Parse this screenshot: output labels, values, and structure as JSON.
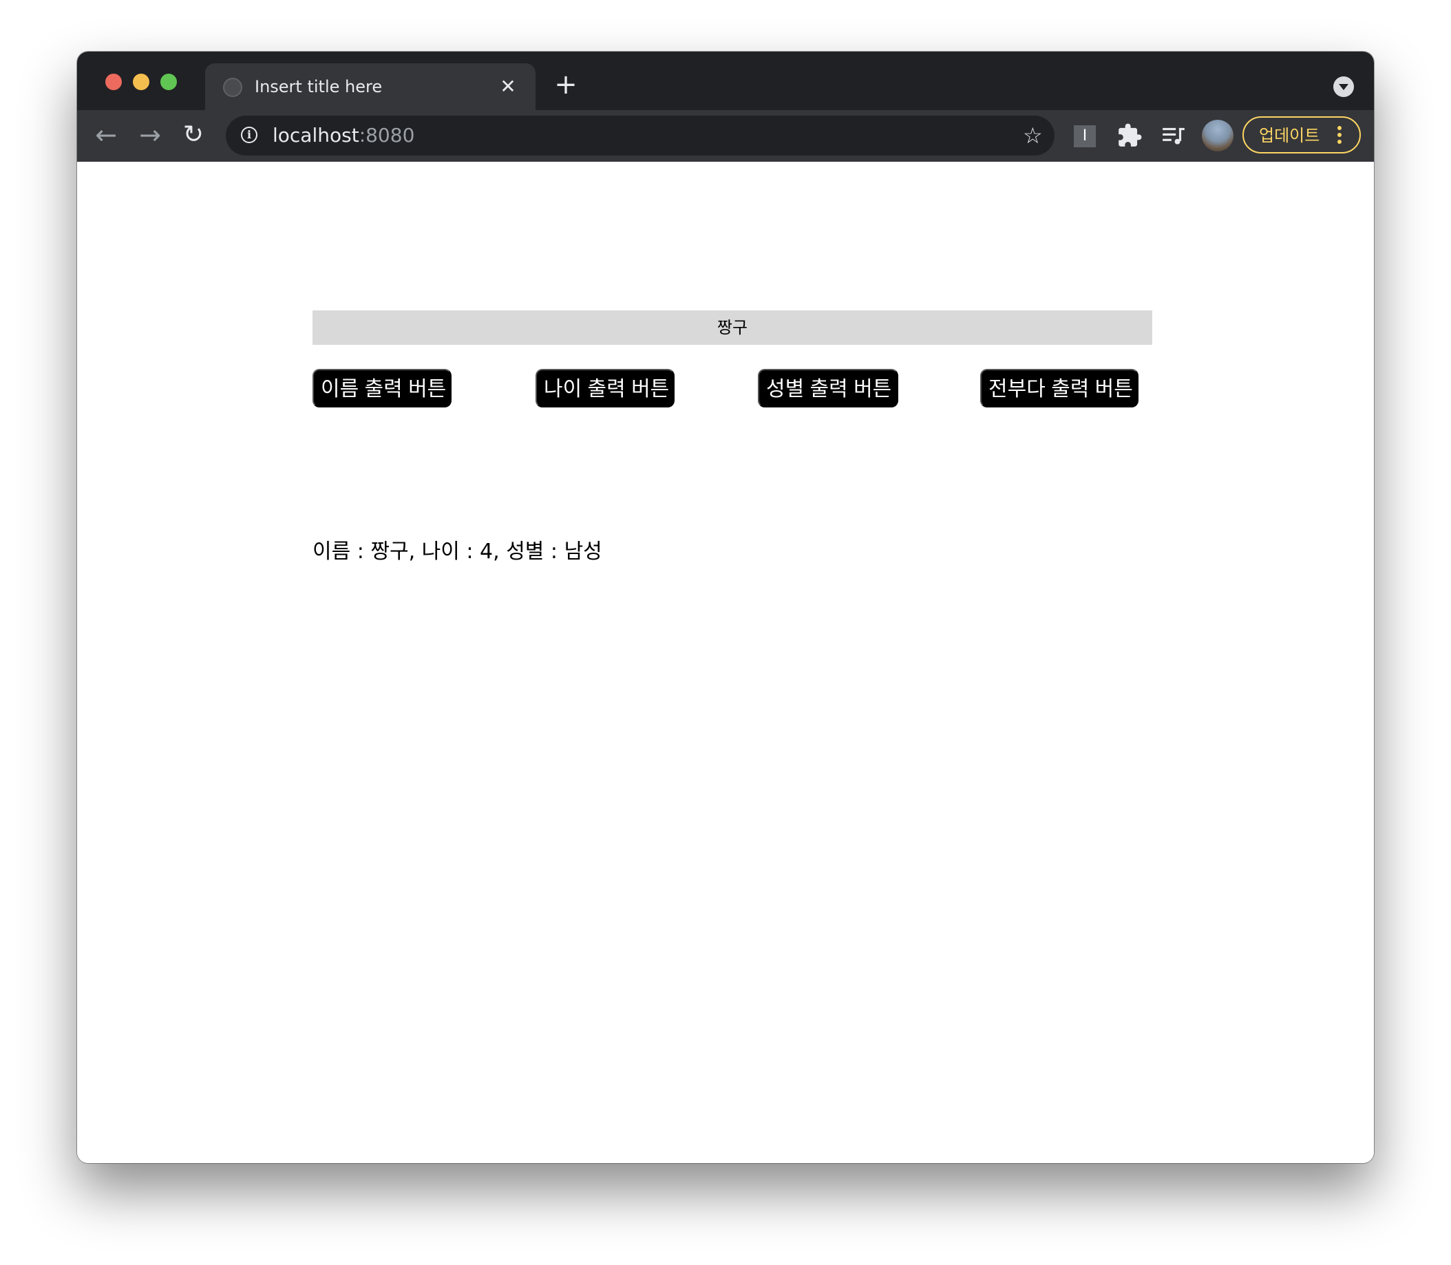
{
  "browser": {
    "tab": {
      "title": "Insert title here",
      "close_glyph": "✕"
    },
    "new_tab_glyph": "+",
    "nav": {
      "back_glyph": "←",
      "forward_glyph": "→",
      "reload_glyph": "↻"
    },
    "address": {
      "host": "localhost",
      "port": ":8080"
    },
    "extension_label": "I",
    "update_button_label": "업데이트",
    "colors": {
      "tabstrip_bg": "#202124",
      "toolbar_bg": "#35363a",
      "update_accent": "#fdd663"
    },
    "icons": [
      "site-favicon-icon",
      "close-icon",
      "plus-icon",
      "back-arrow-icon",
      "forward-arrow-icon",
      "reload-icon",
      "info-icon",
      "star-icon",
      "extension-i-icon",
      "puzzle-icon",
      "media-queue-icon",
      "profile-avatar",
      "more-vert-icon",
      "tab-search-icon"
    ]
  },
  "page": {
    "heading": "짱구",
    "buttons": {
      "name": "이름 출력 버튼",
      "age": "나이 출력 버튼",
      "gender": "성별 출력 버튼",
      "all": "전부다 출력 버튼"
    },
    "result_text": "이름 : 짱구, 나이 : 4, 성별 : 남성",
    "colors": {
      "heading_bg": "#d9d9d9",
      "button_bg": "#000000",
      "button_text": "#ffffff"
    }
  }
}
